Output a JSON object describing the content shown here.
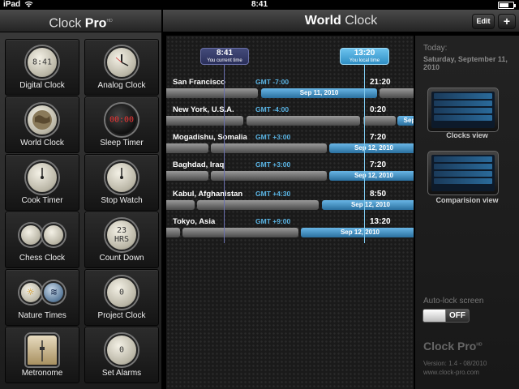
{
  "status_bar": {
    "carrier": "iPad",
    "time": "8:41"
  },
  "left_panel": {
    "title_main": "Clock",
    "title_accent": "Pro",
    "title_sup": "HD",
    "tiles": [
      {
        "label": "Digital Clock",
        "icon": "digital-clock-icon",
        "glyph": "8:41"
      },
      {
        "label": "Analog Clock",
        "icon": "analog-clock-icon",
        "glyph": ""
      },
      {
        "label": "World Clock",
        "icon": "globe-icon",
        "glyph": ""
      },
      {
        "label": "Sleep Timer",
        "icon": "sleep-timer-icon",
        "glyph": "00:00"
      },
      {
        "label": "Cook Timer",
        "icon": "cook-timer-icon",
        "glyph": ""
      },
      {
        "label": "Stop Watch",
        "icon": "stopwatch-icon",
        "glyph": ""
      },
      {
        "label": "Chess Clock",
        "icon": "chess-clock-icon",
        "glyph": ""
      },
      {
        "label": "Count Down",
        "icon": "countdown-icon",
        "glyph": "23 HRS"
      },
      {
        "label": "Nature Times",
        "icon": "nature-times-icon",
        "glyph": ""
      },
      {
        "label": "Project Clock",
        "icon": "project-clock-icon",
        "glyph": "0"
      },
      {
        "label": "Metronome",
        "icon": "metronome-icon",
        "glyph": ""
      },
      {
        "label": "Set Alarms",
        "icon": "alarm-icon",
        "glyph": "0"
      }
    ]
  },
  "header": {
    "title_main": "World",
    "title_rest": "Clock",
    "edit_label": "Edit",
    "add_label": "+"
  },
  "markers": [
    {
      "time": "8:41",
      "sub": "You current time"
    },
    {
      "time": "13:20",
      "sub": "You local time"
    }
  ],
  "cities": [
    {
      "name": "San Francisco",
      "gmt": "GMT -7:00",
      "time": "21:20",
      "date": "Sep 11, 2010"
    },
    {
      "name": "New York, U.S.A.",
      "gmt": "GMT -4:00",
      "time": "0:20",
      "date": "Sep"
    },
    {
      "name": "Mogadishu, Somalia",
      "gmt": "GMT +3:00",
      "time": "7:20",
      "date": "Sep 12, 2010"
    },
    {
      "name": "Baghdad, Iraq",
      "gmt": "GMT +3:00",
      "time": "7:20",
      "date": "Sep 12, 2010"
    },
    {
      "name": "Kabul, Afghanistan",
      "gmt": "GMT +4:30",
      "time": "8:50",
      "date": "Sep 12, 2010"
    },
    {
      "name": "Tokyo, Asia",
      "gmt": "GMT +9:00",
      "time": "13:20",
      "date": "Sep 12, 2010"
    }
  ],
  "right_panel": {
    "today_label": "Today:",
    "today_date": "Saturday, September 11, 2010",
    "clocks_view_label": "Clocks view",
    "comparision_view_label": "Comparision view",
    "autolock_label": "Auto-lock screen",
    "toggle_state": "OFF",
    "brand": "Clock Pro",
    "brand_sup": "HD",
    "version": "Version: 1.4 - 08/2010",
    "url": "www.clock-pro.com"
  },
  "colors": {
    "accent_blue": "#5ab4e4",
    "marker_current": "#3a4070",
    "marker_local": "#4aa8dc"
  }
}
